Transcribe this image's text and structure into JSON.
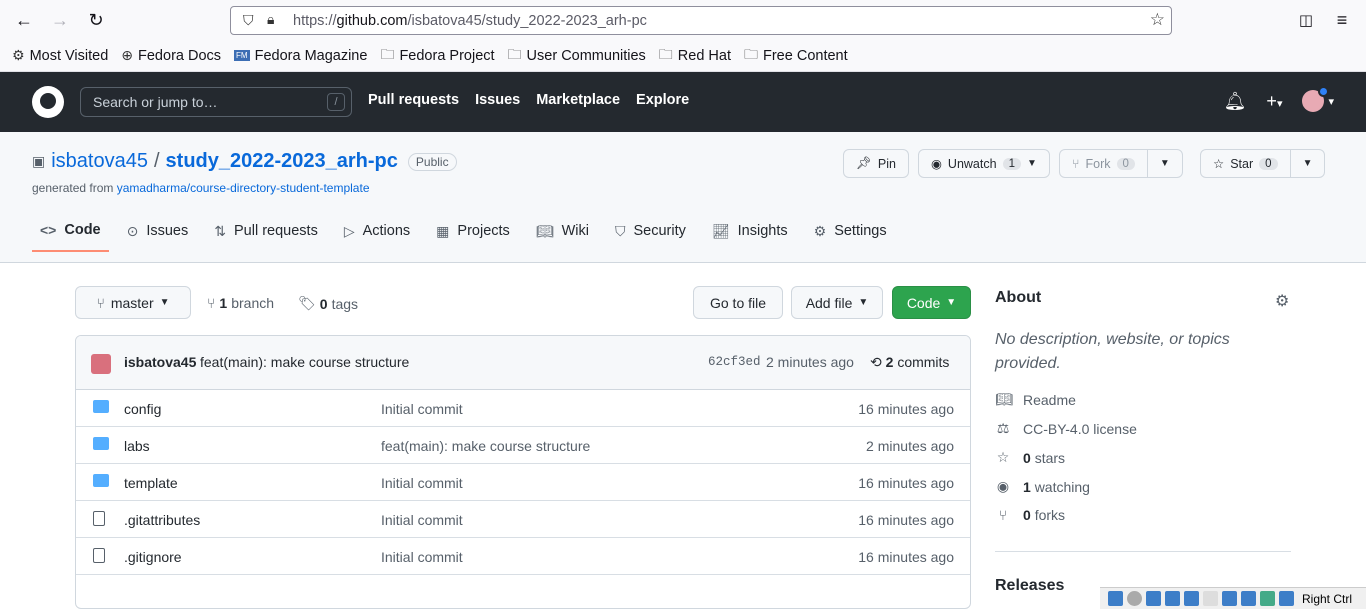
{
  "browser": {
    "url_prefix": "https://",
    "url_domain": "github.com",
    "url_path": "/isbatova45/study_2022-2023_arh-pc",
    "bookmarks": [
      "Most Visited",
      "Fedora Docs",
      "Fedora Magazine",
      "Fedora Project",
      "User Communities",
      "Red Hat",
      "Free Content"
    ]
  },
  "gh_header": {
    "search_placeholder": "Search or jump to…",
    "slash_key": "/",
    "nav": [
      "Pull requests",
      "Issues",
      "Marketplace",
      "Explore"
    ],
    "plus": "+",
    "caret": "▾"
  },
  "repo": {
    "owner": "isbatova45",
    "separator": "/",
    "name": "study_2022-2023_arh-pc",
    "visibility": "Public",
    "generated_prefix": "generated from ",
    "template": "yamadharma/course-directory-student-template",
    "pin": "Pin",
    "unwatch": "Unwatch",
    "watch_count": "1",
    "fork": "Fork",
    "fork_count": "0",
    "star": "Star",
    "star_count": "0",
    "tabs": [
      "Code",
      "Issues",
      "Pull requests",
      "Actions",
      "Projects",
      "Wiki",
      "Security",
      "Insights",
      "Settings"
    ]
  },
  "toolbar": {
    "branch_name": "master",
    "branch_count": "1",
    "branch_label": "branch",
    "tag_count": "0",
    "tag_label": "tags",
    "go_to_file": "Go to file",
    "add_file": "Add file",
    "code": "Code"
  },
  "commit": {
    "author": "isbatova45",
    "message": "feat(main): make course structure",
    "sha": "62cf3ed",
    "age": "2 minutes ago",
    "count": "2",
    "count_label": "commits"
  },
  "files": [
    {
      "name": "config",
      "type": "folder",
      "message": "Initial commit",
      "age": "16 minutes ago"
    },
    {
      "name": "labs",
      "type": "folder",
      "message": "feat(main): make course structure",
      "age": "2 minutes ago"
    },
    {
      "name": "template",
      "type": "folder",
      "message": "Initial commit",
      "age": "16 minutes ago"
    },
    {
      "name": ".gitattributes",
      "type": "file",
      "message": "Initial commit",
      "age": "16 minutes ago"
    },
    {
      "name": ".gitignore",
      "type": "file",
      "message": "Initial commit",
      "age": "16 minutes ago"
    }
  ],
  "about": {
    "title": "About",
    "description": "No description, website, or topics provided.",
    "readme": "Readme",
    "license": "CC-BY-4.0 license",
    "stars_count": "0",
    "stars_label": "stars",
    "watching_count": "1",
    "watching_label": "watching",
    "forks_count": "0",
    "forks_label": "forks",
    "releases": "Releases"
  },
  "vm": {
    "host_key": "Right Ctrl"
  }
}
